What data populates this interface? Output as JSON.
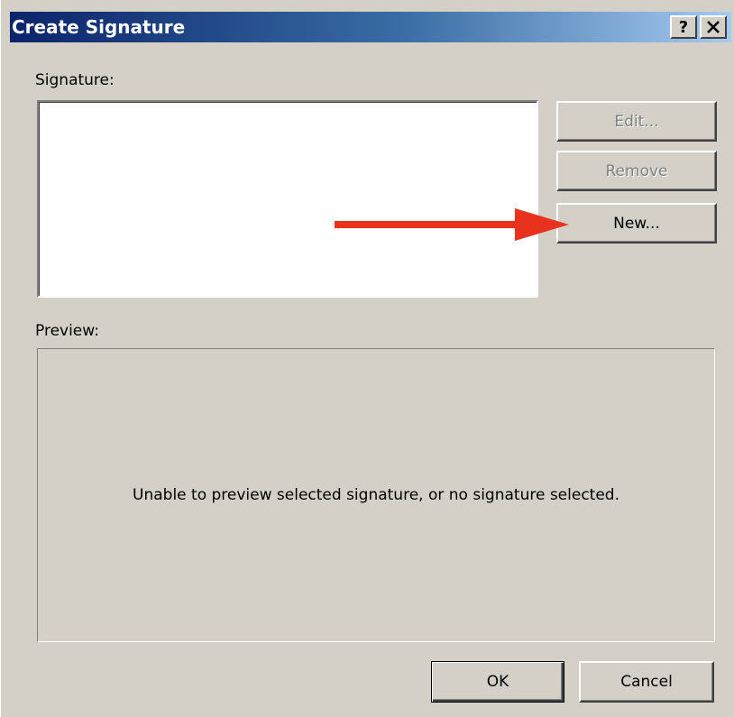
{
  "window": {
    "title": "Create Signature",
    "help_button": "?",
    "close_button": "✕"
  },
  "signature": {
    "label": "Signature:",
    "items": []
  },
  "buttons": {
    "edit": "Edit...",
    "remove": "Remove",
    "new": "New...",
    "ok": "OK",
    "cancel": "Cancel"
  },
  "preview": {
    "label": "Preview:",
    "message": "Unable to preview selected signature, or no signature selected."
  },
  "annotation": {
    "arrow_color": "#e8321e"
  }
}
